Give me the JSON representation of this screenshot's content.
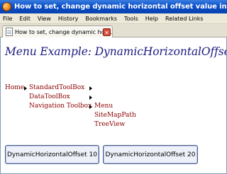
{
  "window": {
    "title": "How to set, change dynamic horizontal offset value in Menu control - Mozilla"
  },
  "menubar": {
    "items": [
      "File",
      "Edit",
      "View",
      "History",
      "Bookmarks",
      "Tools",
      "Help",
      "Related Links"
    ]
  },
  "tab": {
    "title": "How to set, change dynamic hori..."
  },
  "page": {
    "heading": "Menu Example: DynamicHorizontalOffset",
    "menu": {
      "home": "Home",
      "level1": [
        "StandardToolBox",
        "DataToolBox",
        "Navigation Toolbox"
      ],
      "level2": [
        "Menu",
        "SiteMapPath",
        "TreeView"
      ]
    },
    "buttons": {
      "offset10": "DynamicHorizontalOffset 10",
      "offset20": "DynamicHorizontalOffset 20"
    }
  }
}
